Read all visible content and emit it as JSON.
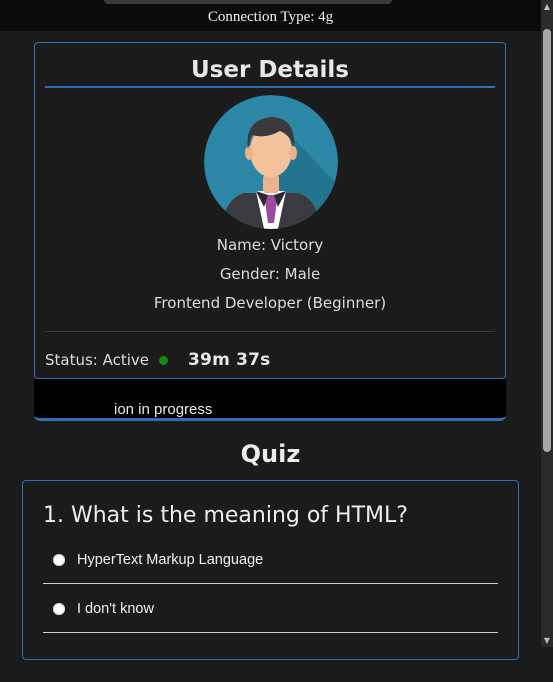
{
  "connection": {
    "label": "Connection Type: 4g"
  },
  "user_card": {
    "title": "User Details",
    "name": "Name: Victory",
    "gender": "Gender: Male",
    "role": "Frontend Developer (Beginner)",
    "status": "Status: Active",
    "timer": "39m 37s",
    "status_color": "#118a11"
  },
  "progress": {
    "text": "ion in progress"
  },
  "quiz": {
    "title": "Quiz",
    "question": "1. What is the meaning of HTML?",
    "options": [
      "HyperText Markup Language",
      "I don't know"
    ]
  },
  "colors": {
    "accent": "#2f6fb6",
    "background": "#1b1b1c"
  }
}
